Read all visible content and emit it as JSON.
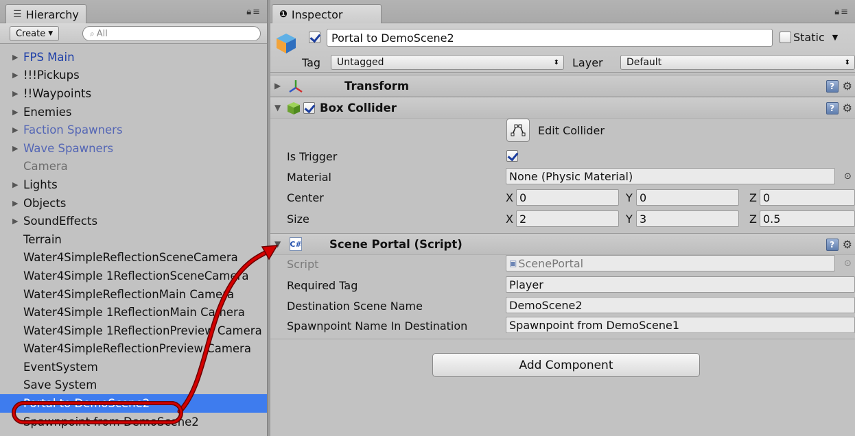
{
  "colors": {
    "selection": "#3e7cee",
    "annotation": "#d40000",
    "prefab_blue": "#1e3fa8"
  },
  "hierarchy": {
    "tab_label": "Hierarchy",
    "tab_icon": "list-icon",
    "create_label": "Create",
    "search_placeholder": "All",
    "items": [
      {
        "label": "FPS Main",
        "expandable": true,
        "style": "blue"
      },
      {
        "label": "!!!Pickups",
        "expandable": true,
        "style": "normal"
      },
      {
        "label": "!!Waypoints",
        "expandable": true,
        "style": "normal"
      },
      {
        "label": "Enemies",
        "expandable": true,
        "style": "normal"
      },
      {
        "label": "Faction Spawners",
        "expandable": true,
        "style": "lightblue"
      },
      {
        "label": "Wave Spawners",
        "expandable": true,
        "style": "lightblue"
      },
      {
        "label": "Camera",
        "expandable": false,
        "style": "gray"
      },
      {
        "label": "Lights",
        "expandable": true,
        "style": "normal"
      },
      {
        "label": "Objects",
        "expandable": true,
        "style": "normal"
      },
      {
        "label": "SoundEffects",
        "expandable": true,
        "style": "normal"
      },
      {
        "label": "Terrain",
        "expandable": false,
        "style": "normal"
      },
      {
        "label": "Water4SimpleReflectionSceneCamera",
        "expandable": false,
        "style": "normal"
      },
      {
        "label": "Water4Simple 1ReflectionSceneCamera",
        "expandable": false,
        "style": "normal"
      },
      {
        "label": "Water4SimpleReflectionMain Camera",
        "expandable": false,
        "style": "normal"
      },
      {
        "label": "Water4Simple 1ReflectionMain Camera",
        "expandable": false,
        "style": "normal"
      },
      {
        "label": "Water4Simple 1ReflectionPreview Camera",
        "expandable": false,
        "style": "normal"
      },
      {
        "label": "Water4SimpleReflectionPreview Camera",
        "expandable": false,
        "style": "normal"
      },
      {
        "label": "EventSystem",
        "expandable": false,
        "style": "normal"
      },
      {
        "label": "Save System",
        "expandable": false,
        "style": "normal"
      },
      {
        "label": "Portal to DemoScene2",
        "expandable": false,
        "style": "selected"
      },
      {
        "label": "Spawnpoint from DemoScene2",
        "expandable": false,
        "style": "normal"
      }
    ]
  },
  "inspector": {
    "tab_label": "Inspector",
    "tab_icon": "info-icon",
    "object_name": "Portal to DemoScene2",
    "static_label": "Static",
    "tag_label": "Tag",
    "tag_value": "Untagged",
    "layer_label": "Layer",
    "layer_value": "Default",
    "transform": {
      "title": "Transform"
    },
    "box_collider": {
      "title": "Box Collider",
      "edit_collider_label": "Edit Collider",
      "is_trigger_label": "Is Trigger",
      "is_trigger": true,
      "material_label": "Material",
      "material_value": "None (Physic Material)",
      "center_label": "Center",
      "center": {
        "x": "0",
        "y": "0",
        "z": "0"
      },
      "size_label": "Size",
      "size": {
        "x": "2",
        "y": "3",
        "z": "0.5"
      },
      "axis": {
        "x": "X",
        "y": "Y",
        "z": "Z"
      }
    },
    "scene_portal": {
      "title": "Scene Portal (Script)",
      "script_label": "Script",
      "script_value": "ScenePortal",
      "required_tag_label": "Required Tag",
      "required_tag_value": "Player",
      "destination_label": "Destination Scene Name",
      "destination_value": "DemoScene2",
      "spawnpoint_label": "Spawnpoint Name In Destination",
      "spawnpoint_value": "Spawnpoint from DemoScene1"
    },
    "add_component_label": "Add Component"
  }
}
